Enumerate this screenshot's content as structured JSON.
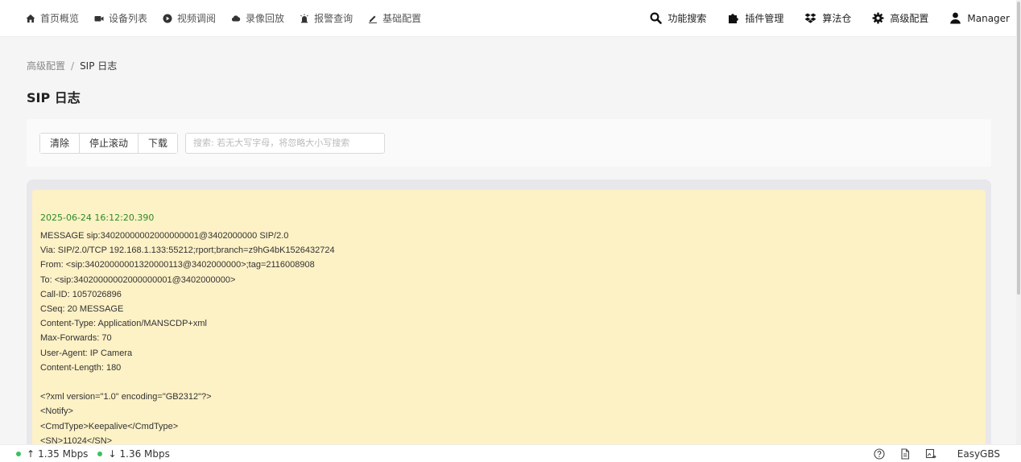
{
  "nav": {
    "items": [
      {
        "label": "首页概览",
        "icon": "home-icon"
      },
      {
        "label": "设备列表",
        "icon": "camera-icon"
      },
      {
        "label": "视频调阅",
        "icon": "play-circle-icon"
      },
      {
        "label": "录像回放",
        "icon": "cloud-icon"
      },
      {
        "label": "报警查询",
        "icon": "alarm-icon"
      },
      {
        "label": "基础配置",
        "icon": "edit-icon"
      }
    ],
    "right": [
      {
        "label": "功能搜索",
        "icon": "search-icon"
      },
      {
        "label": "插件管理",
        "icon": "puzzle-icon"
      },
      {
        "label": "算法仓",
        "icon": "dropbox-icon"
      },
      {
        "label": "高级配置",
        "icon": "gear-icon"
      },
      {
        "label": "Manager",
        "icon": "user-icon"
      }
    ]
  },
  "breadcrumb": {
    "parent": "高级配置",
    "separator": "/",
    "current": "SIP 日志"
  },
  "page": {
    "title": "SIP 日志"
  },
  "toolbar": {
    "clear_label": "清除",
    "stop_scroll_label": "停止滚动",
    "download_label": "下载",
    "search_placeholder": "搜索: 若无大写字母，将忽略大小写搜索",
    "search_value": ""
  },
  "log": {
    "timestamp": "2025-06-24 16:12:20.390",
    "lines": [
      "MESSAGE sip:34020000002000000001@3402000000 SIP/2.0",
      "Via: SIP/2.0/TCP 192.168.1.133:55212;rport;branch=z9hG4bK1526432724",
      "From: <sip:34020000001320000113@3402000000>;tag=2116008908",
      "To: <sip:34020000002000000001@3402000000>",
      "Call-ID: 1057026896",
      "CSeq: 20 MESSAGE",
      "Content-Type: Application/MANSCDP+xml",
      "Max-Forwards: 70",
      "User-Agent: IP Camera",
      "Content-Length: 180",
      "",
      "<?xml version=\"1.0\" encoding=\"GB2312\"?>",
      "<Notify>",
      "<CmdType>Keepalive</CmdType>",
      "<SN>11024</SN>"
    ]
  },
  "status": {
    "up_rate": "1.35 Mbps",
    "down_rate": "1.36 Mbps",
    "up_arrow": "↑",
    "down_arrow": "↓",
    "brand": "EasyGBS"
  },
  "colors": {
    "log_bg": "#fdf1c6",
    "timestamp": "#2e8b25",
    "status_dot": "#3cc060"
  }
}
